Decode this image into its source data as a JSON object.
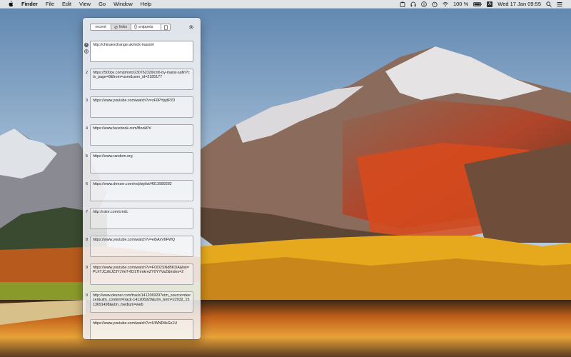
{
  "menubar": {
    "app": "Finder",
    "items": [
      "File",
      "Edit",
      "View",
      "Go",
      "Window",
      "Help"
    ],
    "battery": "100 %",
    "input_source": "A",
    "clock": "Wed 17 Jan  09:55",
    "status_icons": [
      "clipboard-icon",
      "headphones-icon",
      "info-icon",
      "timer-icon",
      "wifi-icon",
      "battery-icon",
      "input-source-icon",
      "search-icon",
      "list-icon"
    ]
  },
  "panel": {
    "tabs": [
      {
        "label": "recent",
        "active": false
      },
      {
        "label": "links",
        "active": true
      },
      {
        "label": "snippets",
        "active": false
      }
    ],
    "entries": [
      {
        "index": "",
        "text": "http://chinaexchange.uk/nick-mason/"
      },
      {
        "index": "2",
        "text": "https://500px.com/photo/230762329/cn6-by-marat-safin?ctx_page=8&from=user&user_id=2185177"
      },
      {
        "index": "3",
        "text": "https://www.youtube.com/watch?v=zF0PYpjdPZ0"
      },
      {
        "index": "4",
        "text": "https://www.facebook.com/BookPr/"
      },
      {
        "index": "5",
        "text": "https://www.random.org"
      },
      {
        "index": "6",
        "text": "https://www.deezer.com/ro/playlist/4013989282"
      },
      {
        "index": "7",
        "text": "http://ralor.com/cmdc"
      },
      {
        "index": "8",
        "text": "https://www.youtube.com/watch?v=ei5AxV6FWQ"
      },
      {
        "index": "9",
        "text": "https://www.youtube.com/watch?v=FOD2SNdBKDA&list=PLhTJCzEJZ3YJVeT-6D1ThmkreZY0YYVaZ&index=2"
      },
      {
        "index": "0",
        "text": "http://www.deezer.com/track/141206929?utm_source=deezer&utm_content=track-141206929&utm_term=22932_1513691498&utm_medium=web"
      },
      {
        "index": "",
        "text": "https://www.youtube.com/watch?v=UWNRtlsGs1U"
      }
    ]
  },
  "colors": {
    "panel_bg": "#f3f3f5",
    "menubar_bg": "#ececec"
  }
}
